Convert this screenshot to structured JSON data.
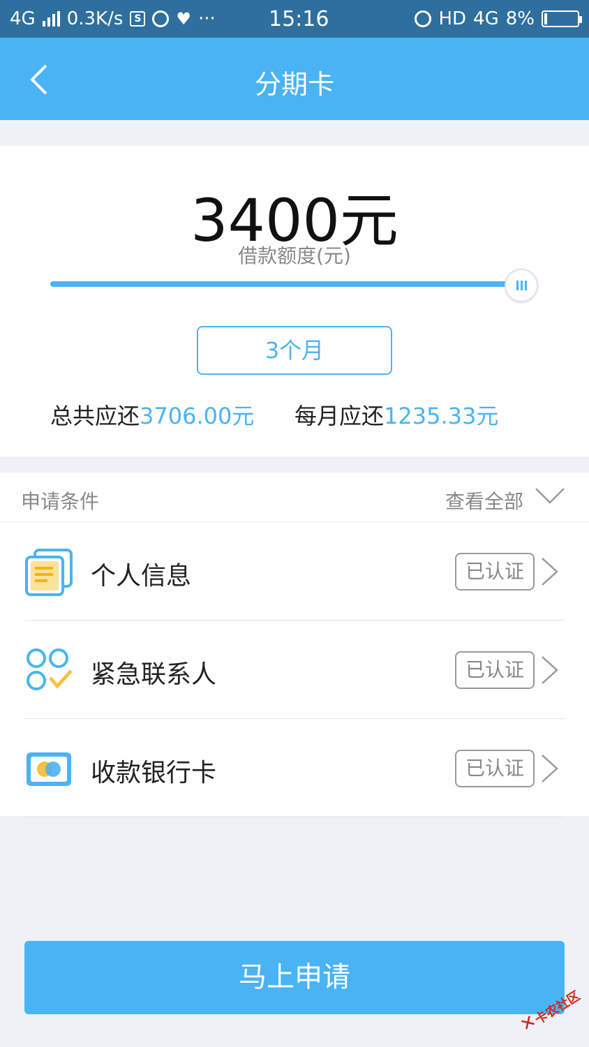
{
  "status_bar": {
    "network": "4G",
    "speed": "0.3K/s",
    "sim_label": "S",
    "more": "···",
    "time": "15:16",
    "hd": "HD",
    "network_right": "4G",
    "battery": "8%",
    "battery_level": 0.08
  },
  "header": {
    "title": "分期卡",
    "back_icon": "chevron-left-icon"
  },
  "loan": {
    "amount": "3400元",
    "amount_label": "借款额度(元)",
    "slider_value": 1.0,
    "term": "3个月",
    "total_label": "总共应还",
    "total_value": "3706.00元",
    "monthly_label": "每月应还",
    "monthly_value": "1235.33元"
  },
  "conditions": {
    "title": "申请条件",
    "view_all": "查看全部",
    "items": [
      {
        "label": "个人信息",
        "status": "已认证",
        "icon": "document-icon"
      },
      {
        "label": "紧急联系人",
        "status": "已认证",
        "icon": "contacts-check-icon"
      },
      {
        "label": "收款银行卡",
        "status": "已认证",
        "icon": "bank-card-icon"
      }
    ]
  },
  "apply_button": "马上申请",
  "watermark": {
    "text": "卡农社区"
  },
  "colors": {
    "accent": "#4ab3f4",
    "status_bar": "#2e6f9e",
    "background": "#eef1f5"
  }
}
